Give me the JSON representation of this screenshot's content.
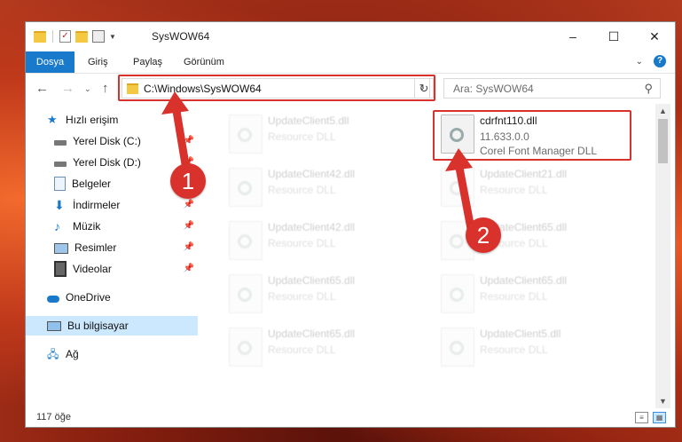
{
  "window": {
    "title": "SysWOW64",
    "controls": [
      "–",
      "☐",
      "✕"
    ]
  },
  "ribbon": {
    "tabs": [
      "Dosya",
      "Giriş",
      "Paylaş",
      "Görünüm"
    ],
    "help": "?"
  },
  "nav": {
    "address": "C:\\Windows\\SysWOW64",
    "search_placeholder": "Ara: SysWOW64"
  },
  "sidebar": {
    "items": [
      {
        "label": "Hızlı erişim",
        "icon": "star-icon",
        "pinned": false
      },
      {
        "label": "Yerel Disk (C:)",
        "icon": "drive-icon",
        "pinned": true
      },
      {
        "label": "Yerel Disk (D:)",
        "icon": "drive-icon",
        "pinned": true
      },
      {
        "label": "Belgeler",
        "icon": "document-icon",
        "pinned": true
      },
      {
        "label": "İndirmeler",
        "icon": "download-icon",
        "pinned": true
      },
      {
        "label": "Müzik",
        "icon": "music-icon",
        "pinned": true
      },
      {
        "label": "Resimler",
        "icon": "pictures-icon",
        "pinned": true
      },
      {
        "label": "Videolar",
        "icon": "video-icon",
        "pinned": true
      },
      {
        "label": "OneDrive",
        "icon": "cloud-icon",
        "pinned": false
      },
      {
        "label": "Bu bilgisayar",
        "icon": "computer-icon",
        "pinned": false,
        "selected": true
      },
      {
        "label": "Ağ",
        "icon": "network-icon",
        "pinned": false
      }
    ]
  },
  "files": {
    "left": [
      {
        "name": "UpdateClient5.dll",
        "type": "Resource DLL"
      },
      {
        "name": "UpdateClient42.dll",
        "type": "Resource DLL"
      },
      {
        "name": "UpdateClient42.dll",
        "type": "Resource DLL"
      },
      {
        "name": "UpdateClient65.dll",
        "type": "Resource DLL"
      },
      {
        "name": "UpdateClient65.dll",
        "type": "Resource DLL"
      }
    ],
    "right": [
      {
        "name": "cdrfnt110.dll",
        "version": "11.633.0.0",
        "type": "Corel Font Manager DLL"
      },
      {
        "name": "UpdateClient21.dll",
        "type": "Resource DLL"
      },
      {
        "name": "UpdateClient65.dll",
        "type": "Resource DLL"
      },
      {
        "name": "UpdateClient65.dll",
        "type": "Resource DLL"
      },
      {
        "name": "UpdateClient5.dll",
        "type": "Resource DLL"
      }
    ]
  },
  "status": {
    "item_count": "117 öğe"
  },
  "annotations": {
    "marker1": "1",
    "marker2": "2",
    "color": "#d9322c"
  }
}
